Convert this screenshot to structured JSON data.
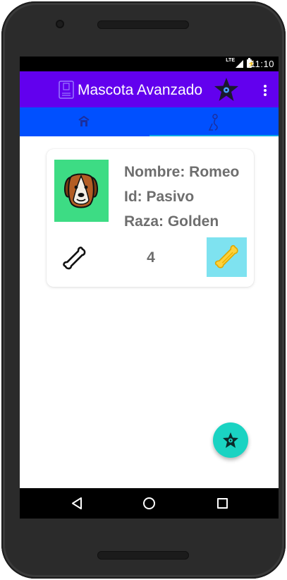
{
  "status_bar": {
    "network": "LTE",
    "time": "11:10"
  },
  "app_bar": {
    "title": "Mascota Avanzado",
    "icons": [
      "phone-icon",
      "star-icon",
      "overflow-menu-icon"
    ],
    "color": "#6200ee"
  },
  "tabs": {
    "color": "#0050ff",
    "indicator_color": "#0aa6e6",
    "items": [
      {
        "icon": "home-icon"
      },
      {
        "icon": "pet-profile-icon"
      }
    ],
    "selected_index": 1
  },
  "pet_card": {
    "photo_icon": "dog-face-icon",
    "photo_bg": "#3ddc84",
    "name_line": "Nombre: Romeo",
    "id_line": "Id: Pasivo",
    "breed_line": "Raza: Golden",
    "bone_icon": "bone-outline-icon",
    "rating_count": "4",
    "rate_icon": "bone-yellow-icon",
    "rate_bg": "#7ee2f0"
  },
  "fab": {
    "icon": "star-icon",
    "color": "#1ad3c2"
  },
  "nav_bar": {
    "buttons": [
      "back-icon",
      "home-icon",
      "recent-apps-icon"
    ]
  }
}
